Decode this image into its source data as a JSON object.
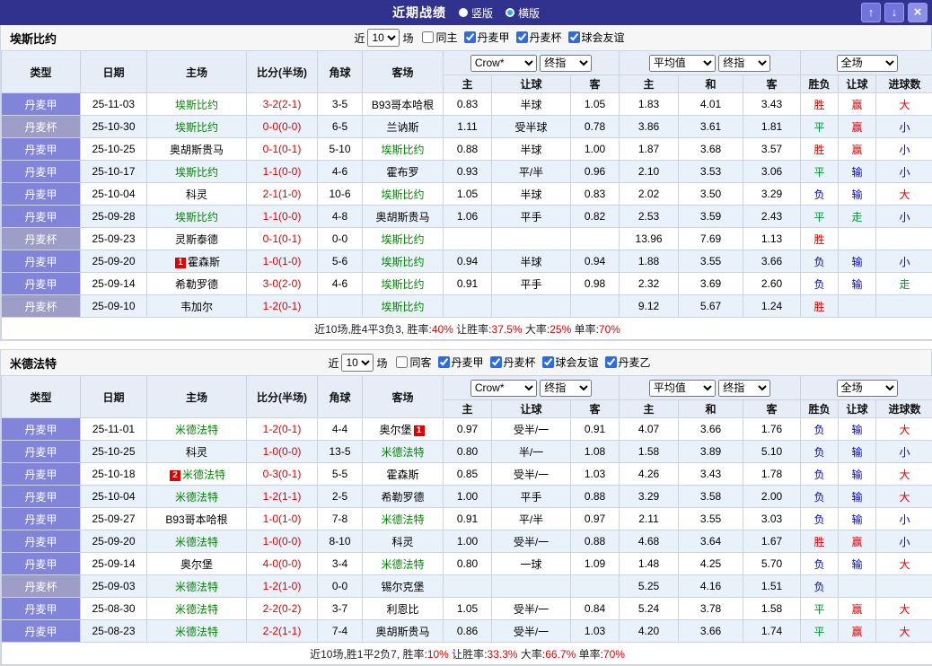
{
  "titlebar": {
    "title": "近期战绩",
    "layout_radios": [
      {
        "label": "竖版",
        "selected": false
      },
      {
        "label": "横版",
        "selected": true
      }
    ],
    "up_icon": "↑",
    "down_icon": "↓",
    "close_icon": "×"
  },
  "filter_labels": {
    "near": "近",
    "games": "场"
  },
  "table_header": {
    "type": "类型",
    "date": "日期",
    "home": "主场",
    "score": "比分(半场)",
    "corner": "角球",
    "away": "客场",
    "book_select": "Crow*",
    "book_time_select": "终指",
    "avg_select": "平均值",
    "avg_time_select": "终指",
    "scope_select": "全场",
    "sub": [
      "主",
      "让球",
      "客",
      "主",
      "和",
      "客",
      "胜负",
      "让球",
      "进球数"
    ]
  },
  "sections": [
    {
      "team": "埃斯比约",
      "filter": {
        "count": "10",
        "checkboxes": [
          {
            "label": "同主",
            "checked": false
          },
          {
            "label": "丹麦甲",
            "checked": true
          },
          {
            "label": "丹麦杯",
            "checked": true
          },
          {
            "label": "球会友谊",
            "checked": true
          }
        ]
      },
      "rows": [
        {
          "type": "丹麦甲",
          "cup": false,
          "date": "25-11-03",
          "home": {
            "name": "埃斯比约",
            "focus": true
          },
          "score": "3-2(2-1)",
          "corner": "3-5",
          "away": {
            "name": "B93哥本哈根",
            "focus": false
          },
          "hcp_home": "0.83",
          "hcp": "半球",
          "hcp_away": "1.05",
          "avg_home": "1.83",
          "avg_draw": "4.01",
          "avg_away": "3.43",
          "res": {
            "t": "胜",
            "c": "red"
          },
          "hres": {
            "t": "赢",
            "c": "red"
          },
          "gres": {
            "t": "大",
            "c": "red"
          }
        },
        {
          "type": "丹麦杯",
          "cup": true,
          "date": "25-10-30",
          "home": {
            "name": "埃斯比约",
            "focus": true
          },
          "score": "0-0(0-0)",
          "corner": "6-5",
          "away": {
            "name": "兰讷斯",
            "focus": false
          },
          "hcp_home": "1.11",
          "hcp": "受半球",
          "hcp_away": "0.78",
          "avg_home": "3.86",
          "avg_draw": "3.61",
          "avg_away": "1.81",
          "res": {
            "t": "平",
            "c": "green"
          },
          "hres": {
            "t": "赢",
            "c": "red"
          },
          "gres": {
            "t": "小",
            "c": "blue"
          }
        },
        {
          "type": "丹麦甲",
          "cup": false,
          "date": "25-10-25",
          "home": {
            "name": "奥胡斯贵马",
            "focus": false
          },
          "score": "0-1(0-1)",
          "corner": "5-10",
          "away": {
            "name": "埃斯比约",
            "focus": true
          },
          "hcp_home": "0.88",
          "hcp": "半球",
          "hcp_away": "1.00",
          "avg_home": "1.87",
          "avg_draw": "3.68",
          "avg_away": "3.57",
          "res": {
            "t": "胜",
            "c": "red"
          },
          "hres": {
            "t": "赢",
            "c": "red"
          },
          "gres": {
            "t": "小",
            "c": "blue"
          }
        },
        {
          "type": "丹麦甲",
          "cup": false,
          "date": "25-10-17",
          "home": {
            "name": "埃斯比约",
            "focus": true
          },
          "score": "1-1(0-0)",
          "corner": "4-6",
          "away": {
            "name": "霍布罗",
            "focus": false
          },
          "hcp_home": "0.93",
          "hcp": "平/半",
          "hcp_away": "0.96",
          "avg_home": "2.10",
          "avg_draw": "3.53",
          "avg_away": "3.06",
          "res": {
            "t": "平",
            "c": "green"
          },
          "hres": {
            "t": "输",
            "c": "blue"
          },
          "gres": {
            "t": "小",
            "c": "blue"
          }
        },
        {
          "type": "丹麦甲",
          "cup": false,
          "date": "25-10-04",
          "home": {
            "name": "科灵",
            "focus": false
          },
          "score": "2-1(1-0)",
          "corner": "10-6",
          "away": {
            "name": "埃斯比约",
            "focus": true
          },
          "hcp_home": "1.05",
          "hcp": "半球",
          "hcp_away": "0.83",
          "avg_home": "2.02",
          "avg_draw": "3.50",
          "avg_away": "3.29",
          "res": {
            "t": "负",
            "c": "blue"
          },
          "hres": {
            "t": "输",
            "c": "blue"
          },
          "gres": {
            "t": "大",
            "c": "red"
          }
        },
        {
          "type": "丹麦甲",
          "cup": false,
          "date": "25-09-28",
          "home": {
            "name": "埃斯比约",
            "focus": true
          },
          "score": "1-1(0-0)",
          "corner": "4-8",
          "away": {
            "name": "奥胡斯贵马",
            "focus": false
          },
          "hcp_home": "1.06",
          "hcp": "平手",
          "hcp_away": "0.82",
          "avg_home": "2.53",
          "avg_draw": "3.59",
          "avg_away": "2.43",
          "res": {
            "t": "平",
            "c": "green"
          },
          "hres": {
            "t": "走",
            "c": "green"
          },
          "gres": {
            "t": "小",
            "c": "blue"
          }
        },
        {
          "type": "丹麦杯",
          "cup": true,
          "date": "25-09-23",
          "home": {
            "name": "灵斯泰德",
            "focus": false
          },
          "score": "0-1(0-1)",
          "corner": "0-0",
          "away": {
            "name": "埃斯比约",
            "focus": true
          },
          "hcp_home": "",
          "hcp": "",
          "hcp_away": "",
          "avg_home": "13.96",
          "avg_draw": "7.69",
          "avg_away": "1.13",
          "res": {
            "t": "胜",
            "c": "red"
          },
          "hres": {
            "t": "",
            "c": ""
          },
          "gres": {
            "t": "",
            "c": ""
          }
        },
        {
          "type": "丹麦甲",
          "cup": false,
          "date": "25-09-20",
          "home": {
            "name": "霍森斯",
            "focus": false,
            "badge": "1",
            "badge_pos": "before"
          },
          "score": "1-0(1-0)",
          "corner": "5-6",
          "away": {
            "name": "埃斯比约",
            "focus": true
          },
          "hcp_home": "0.94",
          "hcp": "半球",
          "hcp_away": "0.94",
          "avg_home": "1.88",
          "avg_draw": "3.55",
          "avg_away": "3.66",
          "res": {
            "t": "负",
            "c": "blue"
          },
          "hres": {
            "t": "输",
            "c": "blue"
          },
          "gres": {
            "t": "小",
            "c": "blue"
          }
        },
        {
          "type": "丹麦甲",
          "cup": false,
          "date": "25-09-14",
          "home": {
            "name": "希勒罗德",
            "focus": false
          },
          "score": "3-0(2-0)",
          "corner": "4-6",
          "away": {
            "name": "埃斯比约",
            "focus": true
          },
          "hcp_home": "0.91",
          "hcp": "平手",
          "hcp_away": "0.98",
          "avg_home": "2.32",
          "avg_draw": "3.69",
          "avg_away": "2.60",
          "res": {
            "t": "负",
            "c": "blue"
          },
          "hres": {
            "t": "输",
            "c": "blue"
          },
          "gres": {
            "t": "走",
            "c": "green"
          }
        },
        {
          "type": "丹麦杯",
          "cup": true,
          "date": "25-09-10",
          "home": {
            "name": "韦加尔",
            "focus": false
          },
          "score": "1-2(0-1)",
          "corner": "",
          "away": {
            "name": "埃斯比约",
            "focus": true
          },
          "hcp_home": "",
          "hcp": "",
          "hcp_away": "",
          "avg_home": "9.12",
          "avg_draw": "5.67",
          "avg_away": "1.24",
          "res": {
            "t": "胜",
            "c": "red"
          },
          "hres": {
            "t": "",
            "c": ""
          },
          "gres": {
            "t": "",
            "c": ""
          }
        }
      ],
      "footer": [
        {
          "t": "近10场,胜4平3负3, 胜率:"
        },
        {
          "t": "40%",
          "red": true
        },
        {
          "t": " 让胜率:"
        },
        {
          "t": "37.5%",
          "red": true
        },
        {
          "t": " 大率:"
        },
        {
          "t": "25%",
          "red": true
        },
        {
          "t": " 单率:"
        },
        {
          "t": "70%",
          "red": true
        }
      ]
    },
    {
      "team": "米德法特",
      "filter": {
        "count": "10",
        "checkboxes": [
          {
            "label": "同客",
            "checked": false
          },
          {
            "label": "丹麦甲",
            "checked": true
          },
          {
            "label": "丹麦杯",
            "checked": true
          },
          {
            "label": "球会友谊",
            "checked": true
          },
          {
            "label": "丹麦乙",
            "checked": true
          }
        ]
      },
      "rows": [
        {
          "type": "丹麦甲",
          "cup": false,
          "date": "25-11-01",
          "home": {
            "name": "米德法特",
            "focus": true
          },
          "score": "1-2(0-1)",
          "corner": "4-4",
          "away": {
            "name": "奥尔堡",
            "focus": false,
            "badge": "1",
            "badge_pos": "after"
          },
          "hcp_home": "0.97",
          "hcp": "受半/一",
          "hcp_away": "0.91",
          "avg_home": "4.07",
          "avg_draw": "3.66",
          "avg_away": "1.76",
          "res": {
            "t": "负",
            "c": "blue"
          },
          "hres": {
            "t": "输",
            "c": "blue"
          },
          "gres": {
            "t": "大",
            "c": "red"
          }
        },
        {
          "type": "丹麦甲",
          "cup": false,
          "date": "25-10-25",
          "home": {
            "name": "科灵",
            "focus": false
          },
          "score": "1-0(0-0)",
          "corner": "13-5",
          "away": {
            "name": "米德法特",
            "focus": true
          },
          "hcp_home": "0.80",
          "hcp": "半/一",
          "hcp_away": "1.08",
          "avg_home": "1.58",
          "avg_draw": "3.89",
          "avg_away": "5.10",
          "res": {
            "t": "负",
            "c": "blue"
          },
          "hres": {
            "t": "输",
            "c": "blue"
          },
          "gres": {
            "t": "小",
            "c": "blue"
          }
        },
        {
          "type": "丹麦甲",
          "cup": false,
          "date": "25-10-18",
          "home": {
            "name": "米德法特",
            "focus": true,
            "badge": "2",
            "badge_pos": "before"
          },
          "score": "0-3(0-1)",
          "corner": "5-5",
          "away": {
            "name": "霍森斯",
            "focus": false
          },
          "hcp_home": "0.85",
          "hcp": "受半/一",
          "hcp_away": "1.03",
          "avg_home": "4.26",
          "avg_draw": "3.43",
          "avg_away": "1.78",
          "res": {
            "t": "负",
            "c": "blue"
          },
          "hres": {
            "t": "输",
            "c": "blue"
          },
          "gres": {
            "t": "大",
            "c": "red"
          }
        },
        {
          "type": "丹麦甲",
          "cup": false,
          "date": "25-10-04",
          "home": {
            "name": "米德法特",
            "focus": true
          },
          "score": "1-2(1-1)",
          "corner": "2-5",
          "away": {
            "name": "希勒罗德",
            "focus": false
          },
          "hcp_home": "1.00",
          "hcp": "平手",
          "hcp_away": "0.88",
          "avg_home": "3.29",
          "avg_draw": "3.58",
          "avg_away": "2.00",
          "res": {
            "t": "负",
            "c": "blue"
          },
          "hres": {
            "t": "输",
            "c": "blue"
          },
          "gres": {
            "t": "大",
            "c": "red"
          }
        },
        {
          "type": "丹麦甲",
          "cup": false,
          "date": "25-09-27",
          "home": {
            "name": "B93哥本哈根",
            "focus": false
          },
          "score": "1-0(1-0)",
          "corner": "7-8",
          "away": {
            "name": "米德法特",
            "focus": true
          },
          "hcp_home": "0.91",
          "hcp": "平/半",
          "hcp_away": "0.97",
          "avg_home": "2.11",
          "avg_draw": "3.55",
          "avg_away": "3.03",
          "res": {
            "t": "负",
            "c": "blue"
          },
          "hres": {
            "t": "输",
            "c": "blue"
          },
          "gres": {
            "t": "小",
            "c": "blue"
          }
        },
        {
          "type": "丹麦甲",
          "cup": false,
          "date": "25-09-20",
          "home": {
            "name": "米德法特",
            "focus": true
          },
          "score": "1-0(0-0)",
          "corner": "8-10",
          "away": {
            "name": "科灵",
            "focus": false
          },
          "hcp_home": "1.00",
          "hcp": "受半/一",
          "hcp_away": "0.88",
          "avg_home": "4.68",
          "avg_draw": "3.64",
          "avg_away": "1.67",
          "res": {
            "t": "胜",
            "c": "red"
          },
          "hres": {
            "t": "赢",
            "c": "red"
          },
          "gres": {
            "t": "小",
            "c": "blue"
          }
        },
        {
          "type": "丹麦甲",
          "cup": false,
          "date": "25-09-14",
          "home": {
            "name": "奥尔堡",
            "focus": false
          },
          "score": "4-0(0-0)",
          "corner": "3-4",
          "away": {
            "name": "米德法特",
            "focus": true
          },
          "hcp_home": "0.80",
          "hcp": "一球",
          "hcp_away": "1.09",
          "avg_home": "1.48",
          "avg_draw": "4.25",
          "avg_away": "5.70",
          "res": {
            "t": "负",
            "c": "blue"
          },
          "hres": {
            "t": "输",
            "c": "blue"
          },
          "gres": {
            "t": "大",
            "c": "red"
          }
        },
        {
          "type": "丹麦杯",
          "cup": true,
          "date": "25-09-03",
          "home": {
            "name": "米德法特",
            "focus": true
          },
          "score": "1-2(1-0)",
          "corner": "0-0",
          "away": {
            "name": "锡尔克堡",
            "focus": false
          },
          "hcp_home": "",
          "hcp": "",
          "hcp_away": "",
          "avg_home": "5.25",
          "avg_draw": "4.16",
          "avg_away": "1.51",
          "res": {
            "t": "负",
            "c": "blue"
          },
          "hres": {
            "t": "",
            "c": ""
          },
          "gres": {
            "t": "",
            "c": ""
          }
        },
        {
          "type": "丹麦甲",
          "cup": false,
          "date": "25-08-30",
          "home": {
            "name": "米德法特",
            "focus": true
          },
          "score": "2-2(0-2)",
          "corner": "3-7",
          "away": {
            "name": "利恩比",
            "focus": false
          },
          "hcp_home": "1.05",
          "hcp": "受半/一",
          "hcp_away": "0.84",
          "avg_home": "5.24",
          "avg_draw": "3.78",
          "avg_away": "1.58",
          "res": {
            "t": "平",
            "c": "green"
          },
          "hres": {
            "t": "赢",
            "c": "red"
          },
          "gres": {
            "t": "大",
            "c": "red"
          }
        },
        {
          "type": "丹麦甲",
          "cup": false,
          "date": "25-08-23",
          "home": {
            "name": "米德法特",
            "focus": true
          },
          "score": "2-2(1-1)",
          "corner": "7-4",
          "away": {
            "name": "奥胡斯贵马",
            "focus": false
          },
          "hcp_home": "0.86",
          "hcp": "受半/一",
          "hcp_away": "1.03",
          "avg_home": "4.20",
          "avg_draw": "3.66",
          "avg_away": "1.74",
          "res": {
            "t": "平",
            "c": "green"
          },
          "hres": {
            "t": "赢",
            "c": "red"
          },
          "gres": {
            "t": "大",
            "c": "red"
          }
        }
      ],
      "footer": [
        {
          "t": "近10场,胜1平2负7, 胜率:"
        },
        {
          "t": "10%",
          "red": true
        },
        {
          "t": " 让胜率:"
        },
        {
          "t": "33.3%",
          "red": true
        },
        {
          "t": " 大率:"
        },
        {
          "t": "66.7%",
          "red": true
        },
        {
          "t": " 单率:"
        },
        {
          "t": "70%",
          "red": true
        }
      ]
    }
  ]
}
